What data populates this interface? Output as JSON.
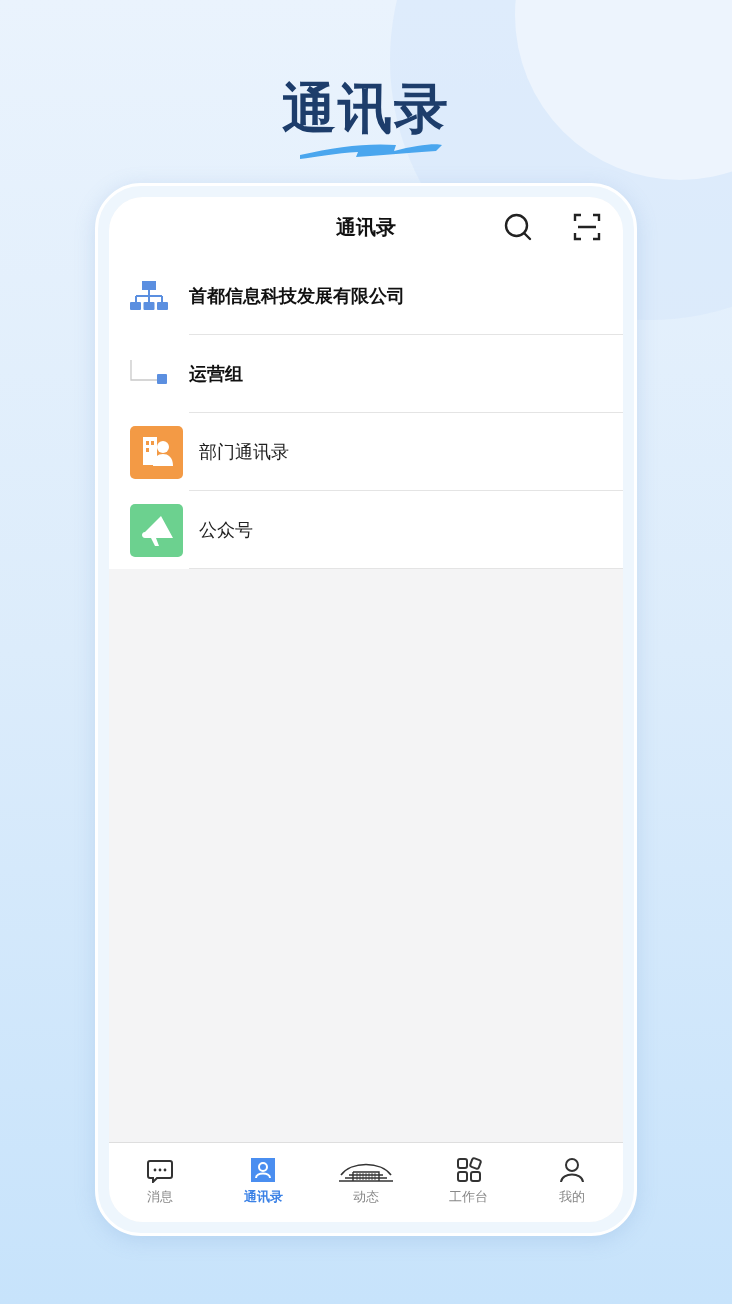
{
  "headline": "通讯录",
  "header": {
    "title": "通讯录"
  },
  "rows": [
    {
      "kind": "org",
      "label": "首都信息科技发展有限公司"
    },
    {
      "kind": "branch",
      "label": "运营组"
    },
    {
      "kind": "directory",
      "label": "部门通讯录",
      "color": "#f39a45"
    },
    {
      "kind": "broadcast",
      "label": "公众号",
      "color": "#6cd18f"
    }
  ],
  "tabs": [
    {
      "label": "消息",
      "selected": false
    },
    {
      "label": "通讯录",
      "selected": true
    },
    {
      "label": "动态",
      "selected": false
    },
    {
      "label": "工作台",
      "selected": false
    },
    {
      "label": "我的",
      "selected": false
    }
  ]
}
